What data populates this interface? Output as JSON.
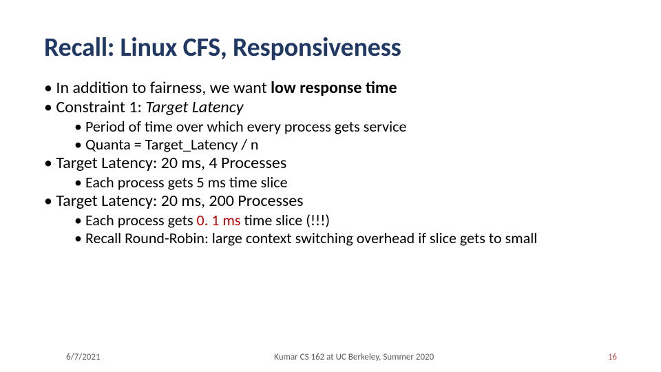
{
  "title": "Recall: Linux CFS, Responsiveness",
  "body": {
    "l1a_pre": "In addition to fairness, we want ",
    "l1a_bold": "low response time",
    "l1b_pre": "Constraint 1: ",
    "l1b_italic": "Target Latency",
    "l2a": "Period of time over which every process gets service",
    "l2b": "Quanta = Target_Latency / n",
    "l1c": "Target Latency: 20 ms, 4 Processes",
    "l2c": "Each process gets 5 ms time slice",
    "l1d": "Target Latency: 20 ms, 200 Processes",
    "l2d_pre": "Each process gets ",
    "l2d_red": "0. 1 ms ",
    "l2d_post": "time slice  (!!!)",
    "l2e": "Recall Round-Robin: large context switching overhead if slice gets to small"
  },
  "footer": {
    "date": "6/7/2021",
    "center": "Kumar CS 162 at UC Berkeley, Summer 2020",
    "slidenum": "16"
  }
}
